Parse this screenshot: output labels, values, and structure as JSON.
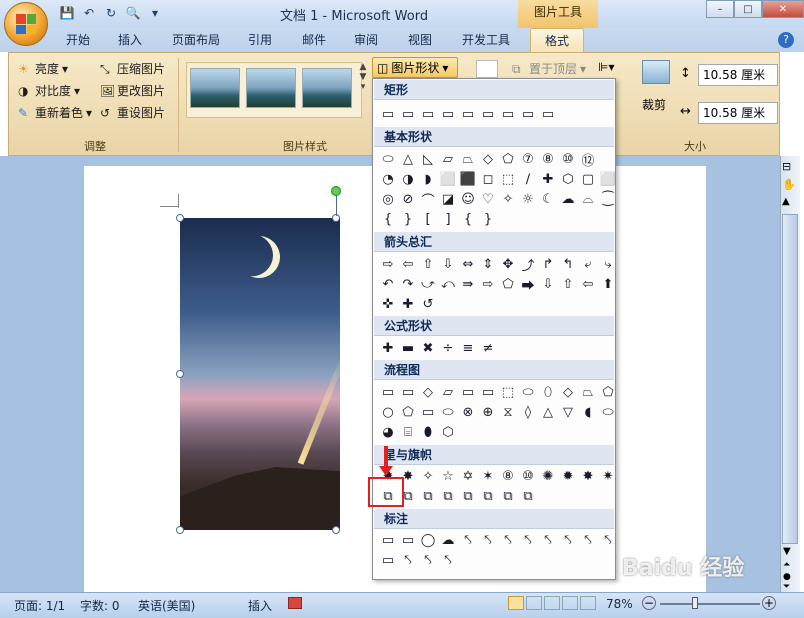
{
  "app": {
    "title": "文档 1 - Microsoft Word",
    "context_tool": "图片工具",
    "window_buttons": [
      "–",
      "□",
      "✕"
    ]
  },
  "tabs": [
    "开始",
    "插入",
    "页面布局",
    "引用",
    "邮件",
    "审阅",
    "视图",
    "开发工具",
    "格式"
  ],
  "active_tab": "格式",
  "ribbon": {
    "adjust": {
      "label": "调整",
      "items": [
        "亮度",
        "对比度",
        "重新着色",
        "压缩图片",
        "更改图片",
        "重设图片"
      ]
    },
    "picture_styles": {
      "label": "图片样式"
    },
    "arrange": {
      "shape_button": "图片形状",
      "bring_to_front": "置于顶层"
    },
    "size": {
      "label": "大小",
      "crop": "裁剪",
      "height": "10.58 厘米",
      "width": "10.58 厘米"
    }
  },
  "gallery": {
    "categories": [
      "矩形",
      "基本形状",
      "箭头总汇",
      "公式形状",
      "流程图",
      "星与旗帜",
      "标注"
    ],
    "shape_rows": {
      "rect": [
        "▭",
        "▭",
        "▭",
        "▭",
        "▭",
        "▭",
        "▭",
        "▭",
        "▭"
      ],
      "basic1": [
        "⬭",
        "△",
        "◺",
        "▱",
        "⏢",
        "◇",
        "⬠",
        "⑦",
        "⑧",
        "⑩",
        "⑫"
      ],
      "basic2": [
        "◔",
        "◑",
        "◗",
        "⬜",
        "⬛",
        "◻",
        "⬚",
        "∕",
        "✚",
        "⬡",
        "▢",
        "⬜"
      ],
      "basic3": [
        "◎",
        "⊘",
        "⌒",
        "◪",
        "☺",
        "♡",
        "✧",
        "☼",
        "☾",
        "☁",
        "⌓",
        "⁐"
      ],
      "basic4": [
        "{",
        "}",
        "[",
        "]",
        "{",
        "}"
      ],
      "arrows1": [
        "⇨",
        "⇦",
        "⇧",
        "⇩",
        "⇔",
        "⇕",
        "✥",
        "⤴",
        "↱",
        "↰",
        "⤶",
        "⤷"
      ],
      "arrows2": [
        "↶",
        "↷",
        "⤻",
        "⤺",
        "⇛",
        "⇨",
        "⬠",
        "⮕",
        "⇩",
        "⇧",
        "⇦",
        "⬆"
      ],
      "arrows3": [
        "✜",
        "✚",
        "↺"
      ],
      "math": [
        "✚",
        "▬",
        "✖",
        "÷",
        "≡",
        "≠"
      ],
      "flow1": [
        "▭",
        "▭",
        "◇",
        "▱",
        "▭",
        "▭",
        "⬚",
        "⬭",
        "⬯",
        "◇",
        "⏢",
        "⬠"
      ],
      "flow2": [
        "○",
        "⬠",
        "▭",
        "⬭",
        "⊗",
        "⊕",
        "⧖",
        "◊",
        "△",
        "▽",
        "◖",
        "⬭"
      ],
      "flow3": [
        "◕",
        "⌸",
        "⬮",
        "⬡"
      ],
      "stars1": [
        "✹",
        "✸",
        "✧",
        "☆",
        "✡",
        "✶",
        "⑧",
        "⑩",
        "✺",
        "✹",
        "✸",
        "✷"
      ],
      "stars2": [
        "⧉",
        "⧉",
        "⧉",
        "⧉",
        "⧉",
        "⧉",
        "⧉",
        "⧉"
      ],
      "callouts1": [
        "▭",
        "▭",
        "◯",
        "☁",
        "⤣",
        "⤣",
        "⤣",
        "⤣",
        "⤣",
        "⤣",
        "⤣",
        "⤣"
      ],
      "callouts2": [
        "▭",
        "⤣",
        "⤣",
        "⤣"
      ]
    }
  },
  "status": {
    "page": "页面: 1/1",
    "words": "字数: 0",
    "language": "英语(美国)",
    "mode": "插入",
    "zoom": "78%"
  },
  "watermark": "Baidu 经验",
  "colors": {
    "ribbon_bg": "#efdcae",
    "doc_bg": "#a7c1e1",
    "highlight": "#e12020"
  }
}
